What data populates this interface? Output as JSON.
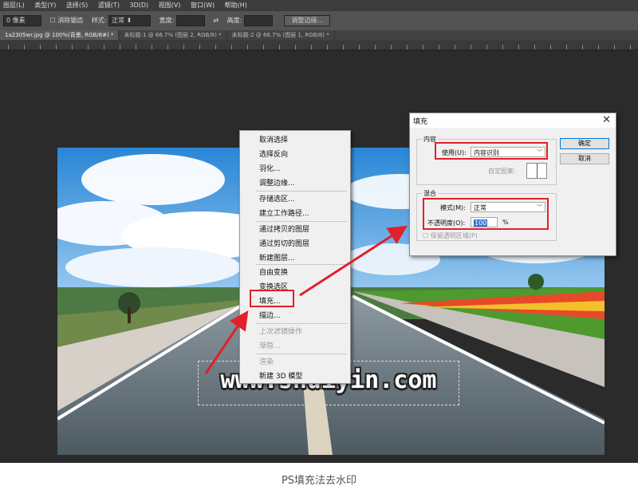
{
  "menubar": [
    "图层(L)",
    "类型(Y)",
    "选择(S)",
    "滤镜(T)",
    "3D(D)",
    "视图(V)",
    "窗口(W)",
    "帮助(H)"
  ],
  "options": {
    "feather": "0 像素",
    "antialias": "消除锯齿",
    "style_label": "样式:",
    "style_value": "正常",
    "width_label": "宽度:",
    "height_label": "高度:",
    "refine_button": "调整边缘..."
  },
  "tabs": [
    "1a2305wr.jpg @ 100%(背景, RGB/8#) *",
    "未标题-1 @ 66.7% (图层 2, RGB/8) *",
    "未标题-2 @ 66.7% (图层 1, RGB/8) *"
  ],
  "context_menu": [
    {
      "label": "取消选择",
      "disabled": false
    },
    {
      "label": "选择反向",
      "disabled": false
    },
    {
      "label": "羽化...",
      "disabled": false
    },
    {
      "label": "调整边缘...",
      "disabled": false
    },
    {
      "label": "存储选区...",
      "disabled": false
    },
    {
      "label": "建立工作路径...",
      "disabled": false
    },
    {
      "label": "通过拷贝的图层",
      "disabled": false
    },
    {
      "label": "通过剪切的图层",
      "disabled": false
    },
    {
      "label": "新建图层...",
      "disabled": false
    },
    {
      "label": "自由变换",
      "disabled": false
    },
    {
      "label": "变换选区",
      "disabled": false
    },
    {
      "label": "填充...",
      "disabled": false
    },
    {
      "label": "描边...",
      "disabled": false
    },
    {
      "label": "上次滤镜操作",
      "disabled": true
    },
    {
      "label": "渐隐...",
      "disabled": true
    },
    {
      "label": "渲染",
      "disabled": true
    },
    {
      "label": "新建 3D 模型",
      "disabled": false
    }
  ],
  "dialog": {
    "title": "填充",
    "content_group": "内容",
    "use_label": "使用(U):",
    "use_value": "内容识别",
    "custom_pattern_label": "自定图案:",
    "blend_group": "混合",
    "mode_label": "模式(M):",
    "mode_value": "正常",
    "opacity_label": "不透明度(O):",
    "opacity_value": "100",
    "opacity_unit": "%",
    "preserve_label": "保留透明区域(P)",
    "ok": "确定",
    "cancel": "取消"
  },
  "watermark": "www.shuiyin.com",
  "caption": "PS填充法去水印",
  "colors": {
    "highlight": "#e0202b",
    "workspace": "#2b2b2b"
  }
}
